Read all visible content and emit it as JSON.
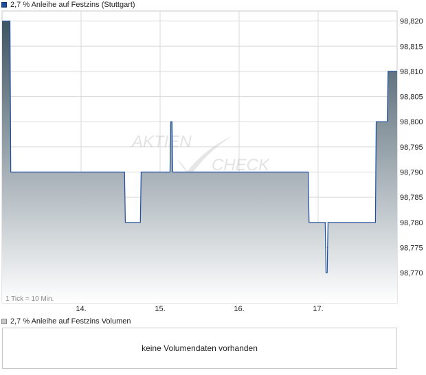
{
  "legend": {
    "price_label": "2,7 % Anleihe auf Festzins (Stuttgart)",
    "volume_label": "2,7 % Anleihe auf Festzins Volumen"
  },
  "watermark": {
    "left": "AKTIEN",
    "right": "CHECK"
  },
  "tick_note": "1 Tick = 10 Min.",
  "volume_message": "keine Volumendaten vorhanden",
  "colors": {
    "line": "#1f4e9c",
    "fill_top": "#3f5563",
    "fill_bottom": "#ffffff",
    "grid": "#d9d9d9"
  },
  "chart_data": {
    "type": "area",
    "step": true,
    "ylim": [
      98.764,
      98.822
    ],
    "y_ticks": [
      "98,770",
      "98,775",
      "98,780",
      "98,785",
      "98,790",
      "98,795",
      "98,800",
      "98,805",
      "98,810",
      "98,815",
      "98,820"
    ],
    "x_ticks": [
      "14.",
      "15.",
      "16.",
      "17."
    ],
    "xlim": [
      0,
      100
    ],
    "x_tick_positions": [
      20,
      40,
      60,
      80
    ],
    "series": [
      {
        "x": [
          0,
          2,
          2.2,
          31,
          31.2,
          35,
          35.2,
          42.5,
          42.7,
          43,
          43.2,
          77.5,
          77.7,
          81.8,
          82,
          82.3,
          82.5,
          94.5,
          94.7,
          97.5,
          97.7,
          100
        ],
        "values": [
          98.82,
          98.82,
          98.79,
          98.79,
          98.78,
          98.78,
          98.79,
          98.79,
          98.8,
          98.8,
          98.79,
          98.79,
          98.78,
          98.78,
          98.77,
          98.77,
          98.78,
          98.78,
          98.8,
          98.8,
          98.81,
          98.81
        ]
      }
    ]
  }
}
